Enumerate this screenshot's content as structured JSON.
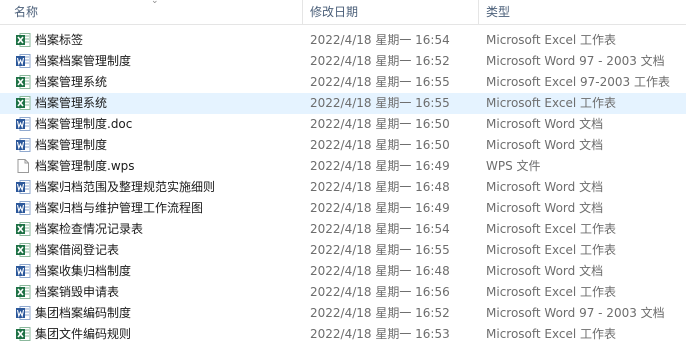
{
  "columns": {
    "name": "名称",
    "modified": "修改日期",
    "type": "类型"
  },
  "files": [
    {
      "name": "档案标签",
      "modified": "2022/4/18 星期一 16:54",
      "type": "Microsoft Excel 工作表",
      "icon": "excel-icon"
    },
    {
      "name": "档案档案管理制度",
      "modified": "2022/4/18 星期一 16:52",
      "type": "Microsoft Word 97 - 2003 文档",
      "icon": "word-doc-icon"
    },
    {
      "name": "档案管理系统",
      "modified": "2022/4/18 星期一 16:55",
      "type": "Microsoft Excel 97-2003 工作表",
      "icon": "excel-icon"
    },
    {
      "name": "档案管理系统",
      "modified": "2022/4/18 星期一 16:55",
      "type": "Microsoft Excel 工作表",
      "icon": "excel-icon",
      "selected": true
    },
    {
      "name": "档案管理制度.doc",
      "modified": "2022/4/18 星期一 16:50",
      "type": "Microsoft Word 文档",
      "icon": "word-doc-icon"
    },
    {
      "name": "档案管理制度",
      "modified": "2022/4/18 星期一 16:50",
      "type": "Microsoft Word 文档",
      "icon": "word-doc-icon"
    },
    {
      "name": "档案管理制度.wps",
      "modified": "2022/4/18 星期一 16:49",
      "type": "WPS 文件",
      "icon": "blank-file-icon"
    },
    {
      "name": "档案归档范围及整理规范实施细则",
      "modified": "2022/4/18 星期一 16:48",
      "type": "Microsoft Word 文档",
      "icon": "word-doc-icon"
    },
    {
      "name": "档案归档与维护管理工作流程图",
      "modified": "2022/4/18 星期一 16:49",
      "type": "Microsoft Word 文档",
      "icon": "word-doc-icon"
    },
    {
      "name": "档案检查情况记录表",
      "modified": "2022/4/18 星期一 16:54",
      "type": "Microsoft Excel 工作表",
      "icon": "excel-icon"
    },
    {
      "name": "档案借阅登记表",
      "modified": "2022/4/18 星期一 16:55",
      "type": "Microsoft Excel 工作表",
      "icon": "excel-icon"
    },
    {
      "name": "档案收集归档制度",
      "modified": "2022/4/18 星期一 16:48",
      "type": "Microsoft Word 文档",
      "icon": "word-doc-icon"
    },
    {
      "name": "档案销毁申请表",
      "modified": "2022/4/18 星期一 16:56",
      "type": "Microsoft Excel 工作表",
      "icon": "excel-icon"
    },
    {
      "name": "集团档案编码制度",
      "modified": "2022/4/18 星期一 16:52",
      "type": "Microsoft Word 97 - 2003 文档",
      "icon": "word-doc-icon"
    },
    {
      "name": "集团文件编码规则",
      "modified": "2022/4/18 星期一 16:53",
      "type": "Microsoft Excel 工作表",
      "icon": "excel-icon"
    }
  ],
  "colors": {
    "excel": "#1e7145",
    "word": "#2b579a",
    "selected_row": "#e5f3ff",
    "header_text": "#4c607a"
  }
}
